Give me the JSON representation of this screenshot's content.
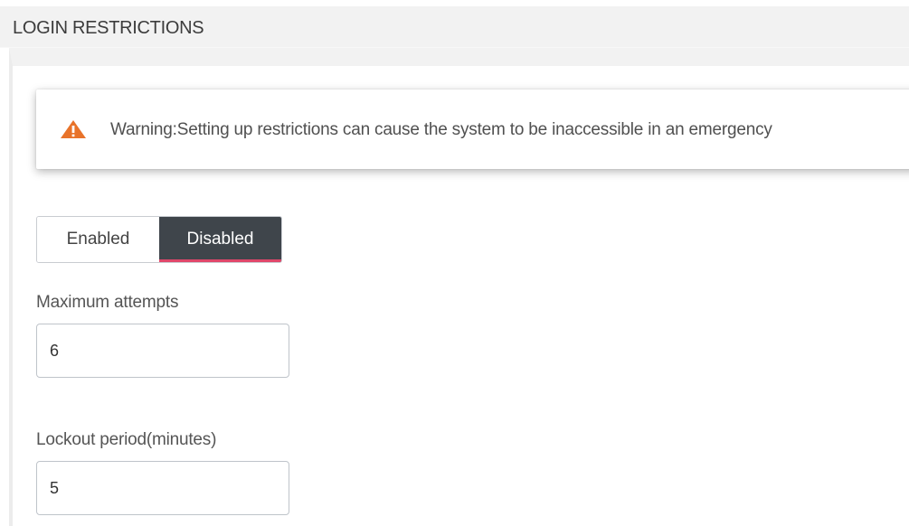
{
  "section": {
    "title": "LOGIN RESTRICTIONS"
  },
  "warning": {
    "icon": "warning-triangle-icon",
    "icon_color": "#e8732a",
    "text": "Warning:Setting up restrictions can cause the system to be inaccessible in an emergency"
  },
  "status_toggle": {
    "enabled_label": "Enabled",
    "disabled_label": "Disabled",
    "selected": "Disabled",
    "selected_bg": "#3f454b",
    "selected_accent": "#e0476a"
  },
  "max_attempts": {
    "label": "Maximum attempts",
    "value": "6"
  },
  "lockout_period": {
    "label": "Lockout period(minutes)",
    "value": "5"
  }
}
